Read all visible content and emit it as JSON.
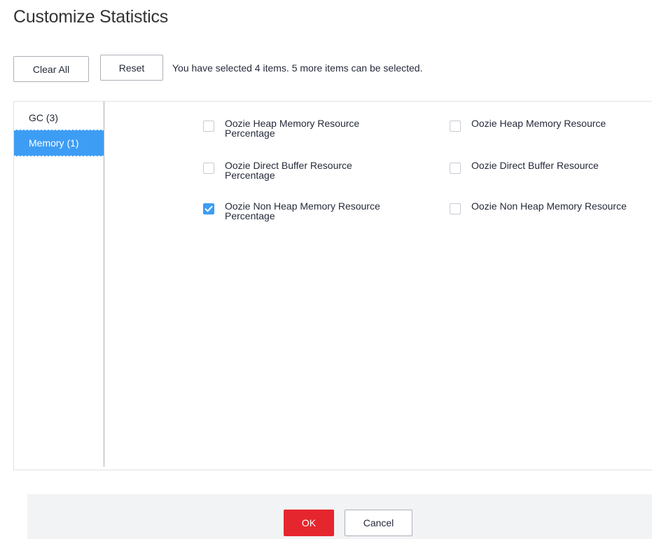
{
  "dialog": {
    "title": "Customize Statistics"
  },
  "toolbar": {
    "clear_all_label": "Clear All",
    "reset_label": "Reset",
    "selection_info": "You have selected 4 items. 5 more items can be selected."
  },
  "categories": [
    {
      "label": "GC (3)",
      "active": false
    },
    {
      "label": "Memory (1)",
      "active": true
    }
  ],
  "options": [
    {
      "label": "Oozie Heap Memory Resource Percentage",
      "checked": false
    },
    {
      "label": "Oozie Heap Memory Resource",
      "checked": false
    },
    {
      "label": "Oozie Direct Buffer Resource Percentage",
      "checked": false
    },
    {
      "label": "Oozie Direct Buffer Resource",
      "checked": false
    },
    {
      "label": "Oozie Non Heap Memory Resource Percentage",
      "checked": true
    },
    {
      "label": "Oozie Non Heap Memory Resource",
      "checked": false
    }
  ],
  "footer": {
    "ok_label": "OK",
    "cancel_label": "Cancel"
  },
  "colors": {
    "accent": "#3d9df5",
    "primary_button": "#e6262e"
  }
}
